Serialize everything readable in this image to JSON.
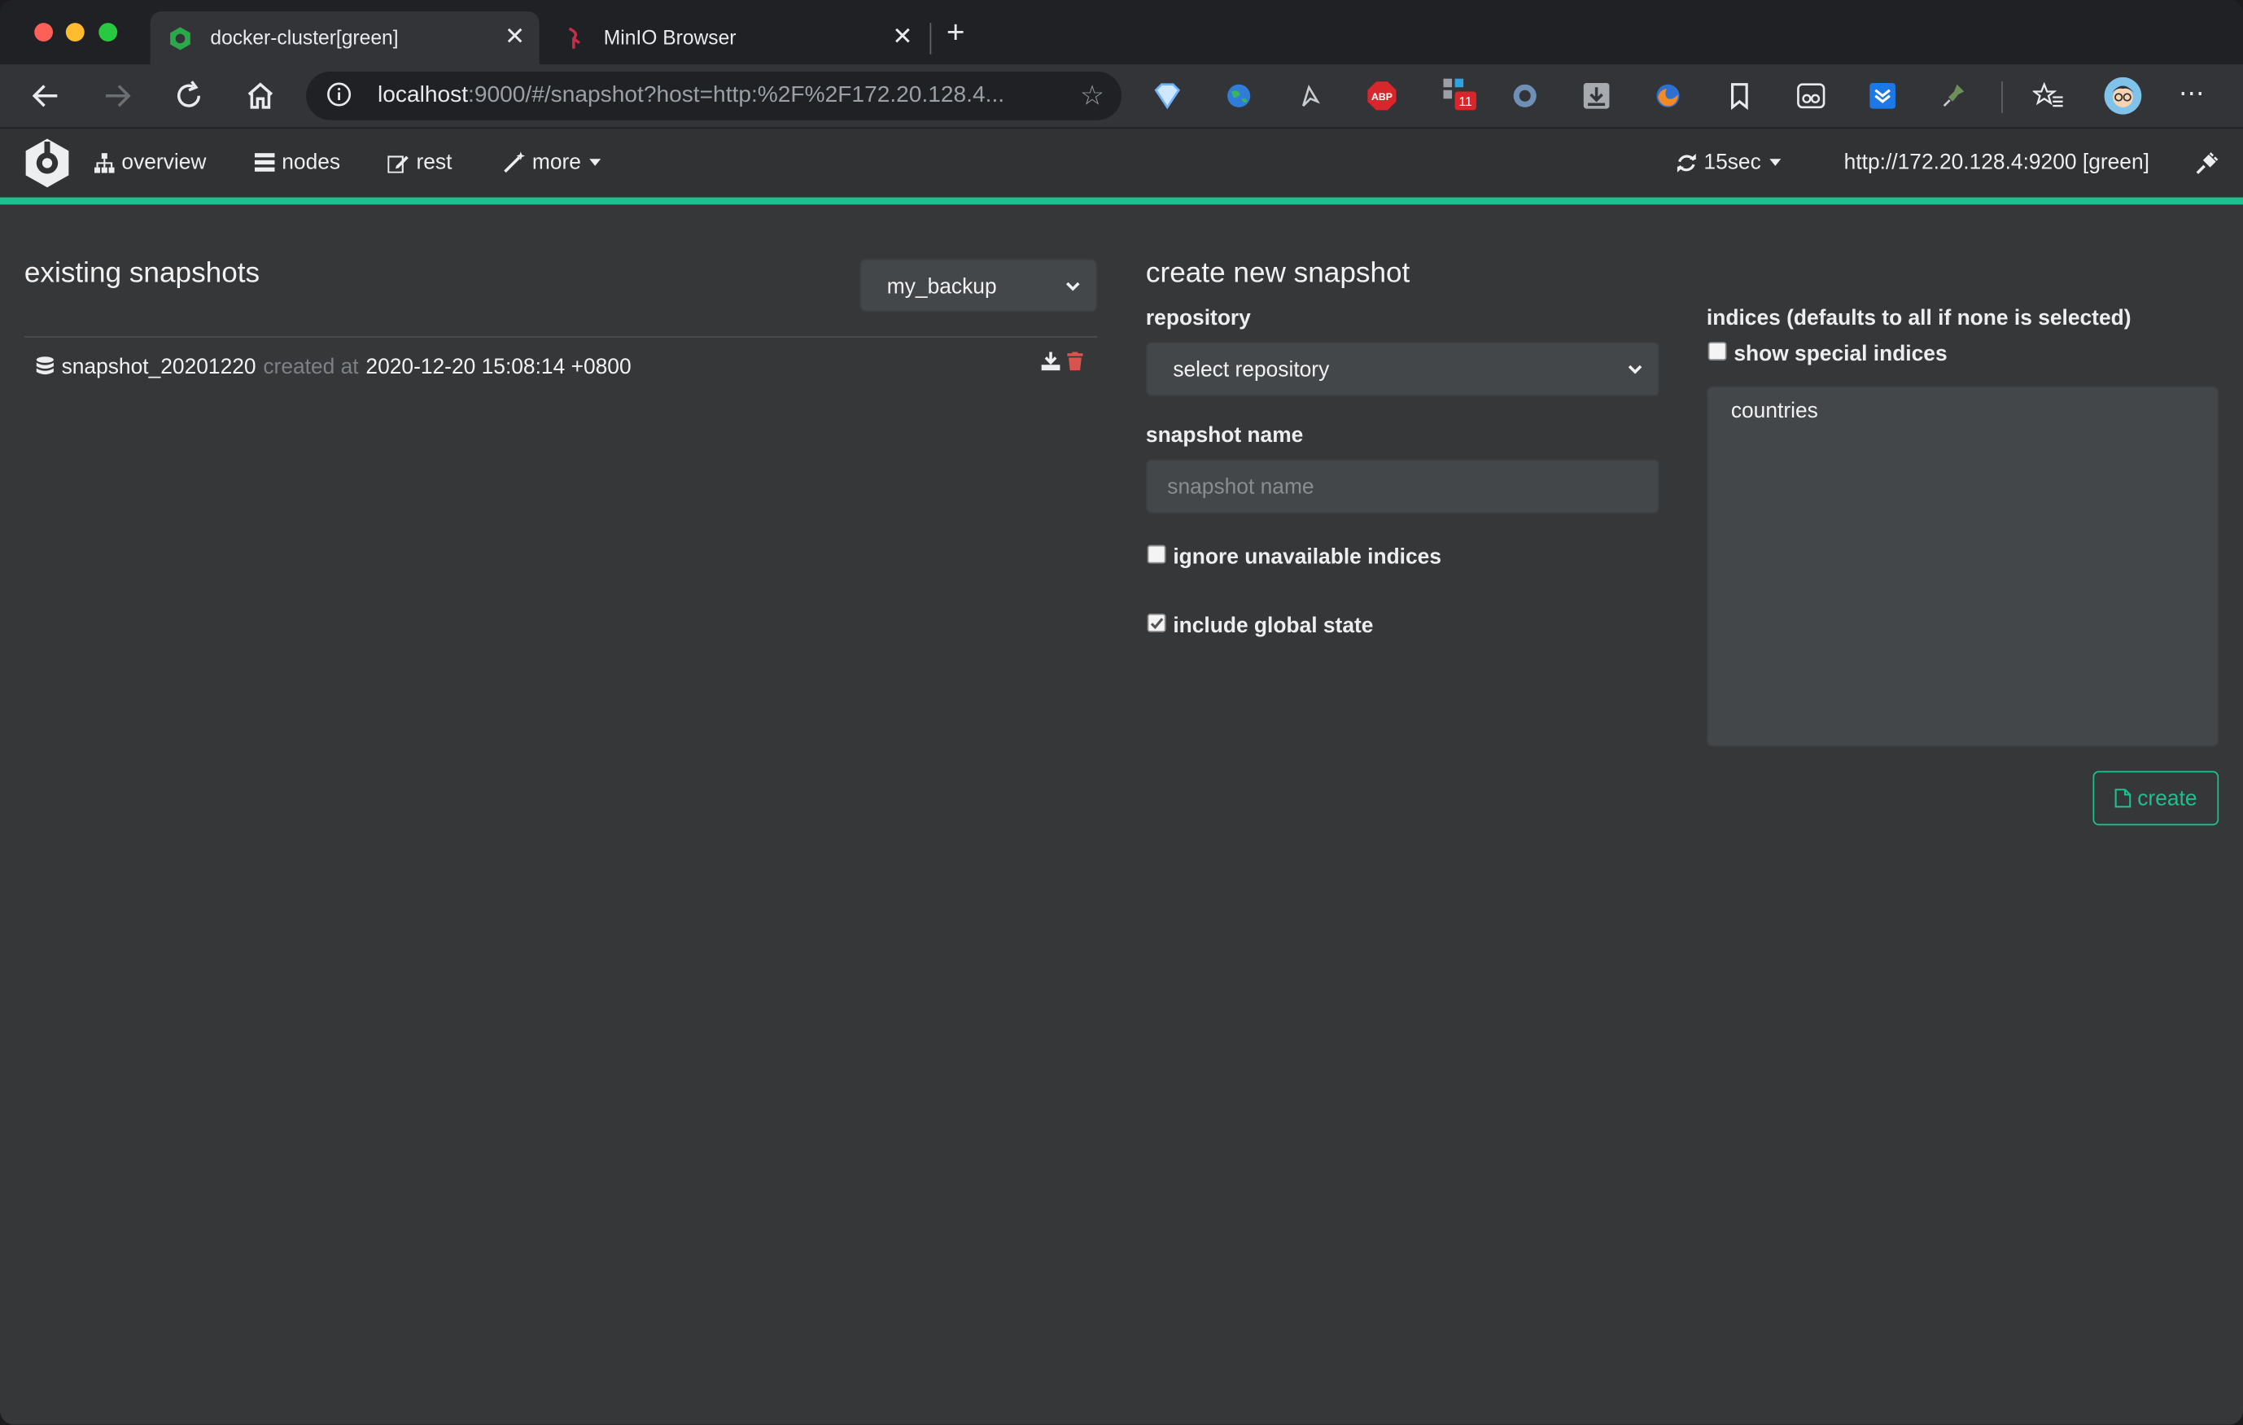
{
  "browser": {
    "tabs": [
      {
        "title": "docker-cluster[green]",
        "active": true,
        "favicon": "cerebro-favicon-icon"
      },
      {
        "title": "MinIO Browser",
        "active": false,
        "favicon": "minio-favicon-icon"
      }
    ],
    "url_host": "localhost",
    "url_rest": ":9000/#/snapshot?host=http:%2F%2F172.20.128.4...",
    "extension_badge": "11",
    "abp_label": "ABP"
  },
  "navbar": {
    "overview": "overview",
    "nodes": "nodes",
    "rest": "rest",
    "more": "more",
    "refresh": "15sec",
    "cluster": "http://172.20.128.4:9200 [green]"
  },
  "existing": {
    "title": "existing snapshots",
    "repository_selected": "my_backup",
    "snapshots": [
      {
        "name": "snapshot_20201220",
        "created_label": "created at",
        "created": "2020-12-20 15:08:14 +0800"
      }
    ]
  },
  "create": {
    "title": "create new snapshot",
    "repository_label": "repository",
    "repository_placeholder": "select repository",
    "snapshot_name_label": "snapshot name",
    "snapshot_name_placeholder": "snapshot name",
    "ignore_unavailable_label": "ignore unavailable indices",
    "ignore_unavailable_checked": false,
    "include_global_label": "include global state",
    "include_global_checked": true,
    "indices_label": "indices (defaults to all if none is selected)",
    "show_special_label": "show special indices",
    "show_special_checked": false,
    "indices": [
      "countries"
    ],
    "create_button": "create"
  },
  "colors": {
    "accent": "#1fbf8f",
    "background": "#353739",
    "delete": "#d9534f"
  }
}
